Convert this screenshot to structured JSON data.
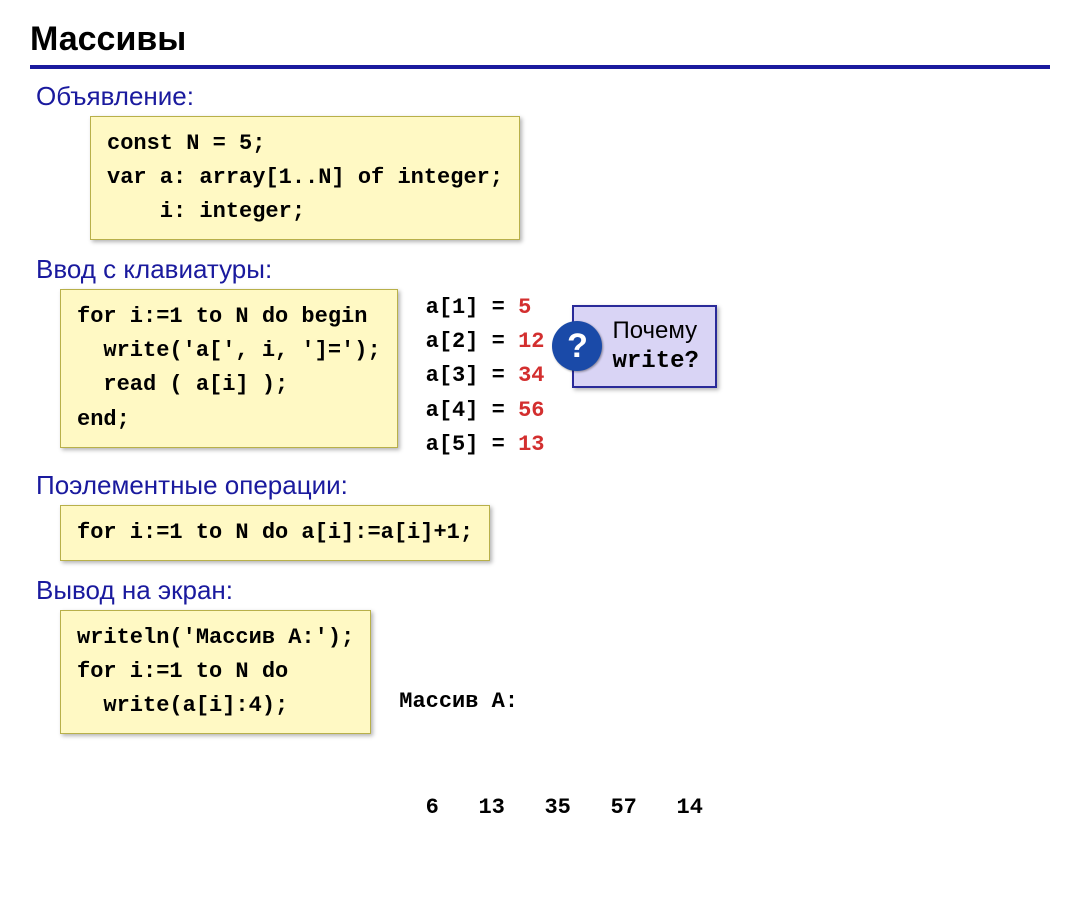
{
  "title": "Массивы",
  "sections": {
    "declaration": {
      "heading": "Объявление:",
      "code": "const N = 5;\nvar a: array[1..N] of integer;\n    i: integer;"
    },
    "input": {
      "heading": "Ввод с клавиатуры:",
      "code": "for i:=1 to N do begin\n  write('a[', i, ']=');\n  read ( a[i] );\nend;",
      "output": [
        {
          "label": "a[1] = ",
          "value": "5"
        },
        {
          "label": "a[2] = ",
          "value": "12"
        },
        {
          "label": "a[3] = ",
          "value": "34"
        },
        {
          "label": "a[4] = ",
          "value": "56"
        },
        {
          "label": "a[5] = ",
          "value": "13"
        }
      ],
      "callout": {
        "icon": "?",
        "line1": "Почему",
        "line2": "write?"
      }
    },
    "ops": {
      "heading": "Поэлементные операции:",
      "code": "for i:=1 to N do a[i]:=a[i]+1;"
    },
    "output": {
      "heading": "Вывод на экран:",
      "code": "writeln('Массив A:');\nfor i:=1 to N do\n  write(a[i]:4);",
      "result_label": "Массив A:",
      "result_values": "  6   13   35   57   14"
    }
  }
}
